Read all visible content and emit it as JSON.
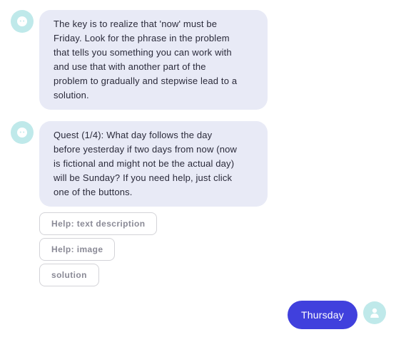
{
  "messages": [
    {
      "sender": "bot",
      "avatar_icon": "bot-face-icon",
      "text": "The key is to realize that 'now' must be\nFriday. Look for the phrase in the problem\nthat tells you something you can work with\nand use that with another part of the\nproblem to gradually and stepwise lead to a\nsolution."
    },
    {
      "sender": "bot",
      "avatar_icon": "bot-face-icon",
      "text": "Quest (1/4): What day follows the day\nbefore yesterday if two days from now (now\nis fictional and might not be the actual day)\nwill be Sunday? If you need help, just click\none of the buttons."
    }
  ],
  "options": [
    {
      "label": "Help: text description"
    },
    {
      "label": "Help: image"
    },
    {
      "label": "solution"
    }
  ],
  "user_reply": {
    "text": "Thursday",
    "avatar_icon": "user-icon"
  },
  "colors": {
    "bot_bubble": "#e8eaf6",
    "avatar_bg": "#bfe9ea",
    "user_bubble": "#4040dd",
    "button_border": "#d3d3d8",
    "button_text": "#8a8a96"
  }
}
